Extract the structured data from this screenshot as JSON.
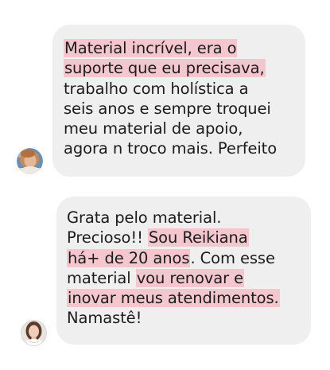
{
  "messages": [
    {
      "lines": [
        [
          {
            "text": "Material incrível, era o",
            "hl": true
          }
        ],
        [
          {
            "text": "suporte que eu precisava,",
            "hl": true
          }
        ],
        [
          {
            "text": "trabalho com holística a",
            "hl": false
          }
        ],
        [
          {
            "text": "seis anos e sempre troquei",
            "hl": false
          }
        ],
        [
          {
            "text": "meu material de apoio,",
            "hl": false
          }
        ],
        [
          {
            "text": "agora n troco mais. Perfeito",
            "hl": false
          }
        ]
      ]
    },
    {
      "lines": [
        [
          {
            "text": "Grata pelo material.",
            "hl": false
          }
        ],
        [
          {
            "text": "Precioso!! ",
            "hl": false
          },
          {
            "text": "Sou Reikiana",
            "hl": true
          }
        ],
        [
          {
            "text": "há+ de 20 anos",
            "hl": true
          },
          {
            "text": ". Com esse",
            "hl": false
          }
        ],
        [
          {
            "text": "material ",
            "hl": false
          },
          {
            "text": "vou renovar e",
            "hl": true
          }
        ],
        [
          {
            "text": "inovar meus atendimentos.",
            "hl": true
          }
        ],
        [
          {
            "text": "Namastê!",
            "hl": false
          }
        ]
      ]
    }
  ],
  "colors": {
    "bubble_background": "#efefef",
    "highlight": "#f4c6cd",
    "text": "#1c1c1c"
  }
}
